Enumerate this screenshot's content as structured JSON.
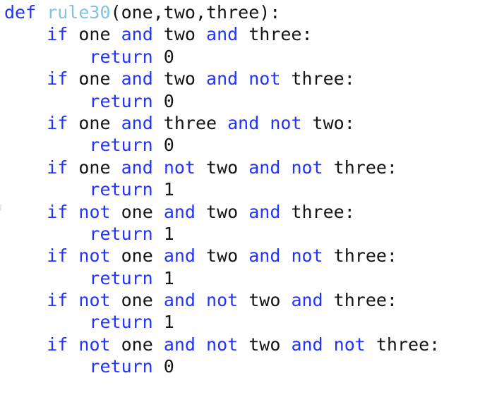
{
  "editor": {
    "language": "python",
    "background_color": "#ffffff",
    "keyword_color": "#2233ff",
    "function_name_color": "#82c3e0",
    "text_color": "#141414",
    "function_name": "rule30",
    "indent_unit": "    "
  },
  "code": {
    "lines": [
      {
        "id": "line-1",
        "indent": 0,
        "tokens": [
          {
            "t": "def",
            "k": "kw"
          },
          {
            "t": " ",
            "k": "plain"
          },
          {
            "t": "rule30",
            "k": "fn"
          },
          {
            "t": "(one,two,three):",
            "k": "punct"
          }
        ]
      },
      {
        "id": "line-2",
        "indent": 1,
        "tokens": [
          {
            "t": "if",
            "k": "kw"
          },
          {
            "t": " one ",
            "k": "plain"
          },
          {
            "t": "and",
            "k": "kw"
          },
          {
            "t": " two ",
            "k": "plain"
          },
          {
            "t": "and",
            "k": "kw"
          },
          {
            "t": " three:",
            "k": "plain"
          }
        ]
      },
      {
        "id": "line-3",
        "indent": 2,
        "tokens": [
          {
            "t": "return",
            "k": "kw"
          },
          {
            "t": " ",
            "k": "plain"
          },
          {
            "t": "0",
            "k": "num"
          }
        ]
      },
      {
        "id": "line-4",
        "indent": 1,
        "tokens": [
          {
            "t": "if",
            "k": "kw"
          },
          {
            "t": " one ",
            "k": "plain"
          },
          {
            "t": "and",
            "k": "kw"
          },
          {
            "t": " two ",
            "k": "plain"
          },
          {
            "t": "and",
            "k": "kw"
          },
          {
            "t": " ",
            "k": "plain"
          },
          {
            "t": "not",
            "k": "kw"
          },
          {
            "t": " three:",
            "k": "plain"
          }
        ]
      },
      {
        "id": "line-5",
        "indent": 2,
        "tokens": [
          {
            "t": "return",
            "k": "kw"
          },
          {
            "t": " ",
            "k": "plain"
          },
          {
            "t": "0",
            "k": "num"
          }
        ]
      },
      {
        "id": "line-6",
        "indent": 1,
        "tokens": [
          {
            "t": "if",
            "k": "kw"
          },
          {
            "t": " one ",
            "k": "plain"
          },
          {
            "t": "and",
            "k": "kw"
          },
          {
            "t": " three ",
            "k": "plain"
          },
          {
            "t": "and",
            "k": "kw"
          },
          {
            "t": " ",
            "k": "plain"
          },
          {
            "t": "not",
            "k": "kw"
          },
          {
            "t": " two:",
            "k": "plain"
          }
        ]
      },
      {
        "id": "line-7",
        "indent": 2,
        "tokens": [
          {
            "t": "return",
            "k": "kw"
          },
          {
            "t": " ",
            "k": "plain"
          },
          {
            "t": "0",
            "k": "num"
          }
        ]
      },
      {
        "id": "line-8",
        "indent": 1,
        "tokens": [
          {
            "t": "if",
            "k": "kw"
          },
          {
            "t": " one ",
            "k": "plain"
          },
          {
            "t": "and",
            "k": "kw"
          },
          {
            "t": " ",
            "k": "plain"
          },
          {
            "t": "not",
            "k": "kw"
          },
          {
            "t": " two ",
            "k": "plain"
          },
          {
            "t": "and",
            "k": "kw"
          },
          {
            "t": " ",
            "k": "plain"
          },
          {
            "t": "not",
            "k": "kw"
          },
          {
            "t": " three:",
            "k": "plain"
          }
        ]
      },
      {
        "id": "line-9",
        "indent": 2,
        "tokens": [
          {
            "t": "return",
            "k": "kw"
          },
          {
            "t": " ",
            "k": "plain"
          },
          {
            "t": "1",
            "k": "num"
          }
        ]
      },
      {
        "id": "line-10",
        "indent": 1,
        "tokens": [
          {
            "t": "if",
            "k": "kw"
          },
          {
            "t": " ",
            "k": "plain"
          },
          {
            "t": "not",
            "k": "kw"
          },
          {
            "t": " one ",
            "k": "plain"
          },
          {
            "t": "and",
            "k": "kw"
          },
          {
            "t": " two ",
            "k": "plain"
          },
          {
            "t": "and",
            "k": "kw"
          },
          {
            "t": " three:",
            "k": "plain"
          }
        ]
      },
      {
        "id": "line-11",
        "indent": 2,
        "tokens": [
          {
            "t": "return",
            "k": "kw"
          },
          {
            "t": " ",
            "k": "plain"
          },
          {
            "t": "1",
            "k": "num"
          }
        ]
      },
      {
        "id": "line-12",
        "indent": 1,
        "tokens": [
          {
            "t": "if",
            "k": "kw"
          },
          {
            "t": " ",
            "k": "plain"
          },
          {
            "t": "not",
            "k": "kw"
          },
          {
            "t": " one ",
            "k": "plain"
          },
          {
            "t": "and",
            "k": "kw"
          },
          {
            "t": " two ",
            "k": "plain"
          },
          {
            "t": "and",
            "k": "kw"
          },
          {
            "t": " ",
            "k": "plain"
          },
          {
            "t": "not",
            "k": "kw"
          },
          {
            "t": " three:",
            "k": "plain"
          }
        ]
      },
      {
        "id": "line-13",
        "indent": 2,
        "tokens": [
          {
            "t": "return",
            "k": "kw"
          },
          {
            "t": " ",
            "k": "plain"
          },
          {
            "t": "1",
            "k": "num"
          }
        ]
      },
      {
        "id": "line-14",
        "indent": 1,
        "tokens": [
          {
            "t": "if",
            "k": "kw"
          },
          {
            "t": " ",
            "k": "plain"
          },
          {
            "t": "not",
            "k": "kw"
          },
          {
            "t": " one ",
            "k": "plain"
          },
          {
            "t": "and",
            "k": "kw"
          },
          {
            "t": " ",
            "k": "plain"
          },
          {
            "t": "not",
            "k": "kw"
          },
          {
            "t": " two ",
            "k": "plain"
          },
          {
            "t": "and",
            "k": "kw"
          },
          {
            "t": " three:",
            "k": "plain"
          }
        ]
      },
      {
        "id": "line-15",
        "indent": 2,
        "tokens": [
          {
            "t": "return",
            "k": "kw"
          },
          {
            "t": " ",
            "k": "plain"
          },
          {
            "t": "1",
            "k": "num"
          }
        ]
      },
      {
        "id": "line-16",
        "indent": 1,
        "tokens": [
          {
            "t": "if",
            "k": "kw"
          },
          {
            "t": " ",
            "k": "plain"
          },
          {
            "t": "not",
            "k": "kw"
          },
          {
            "t": " one ",
            "k": "plain"
          },
          {
            "t": "and",
            "k": "kw"
          },
          {
            "t": " ",
            "k": "plain"
          },
          {
            "t": "not",
            "k": "kw"
          },
          {
            "t": " two ",
            "k": "plain"
          },
          {
            "t": "and",
            "k": "kw"
          },
          {
            "t": " ",
            "k": "plain"
          },
          {
            "t": "not",
            "k": "kw"
          },
          {
            "t": " three:",
            "k": "plain"
          }
        ]
      },
      {
        "id": "line-17",
        "indent": 2,
        "tokens": [
          {
            "t": "return",
            "k": "kw"
          },
          {
            "t": " ",
            "k": "plain"
          },
          {
            "t": "0",
            "k": "num"
          }
        ]
      }
    ]
  }
}
